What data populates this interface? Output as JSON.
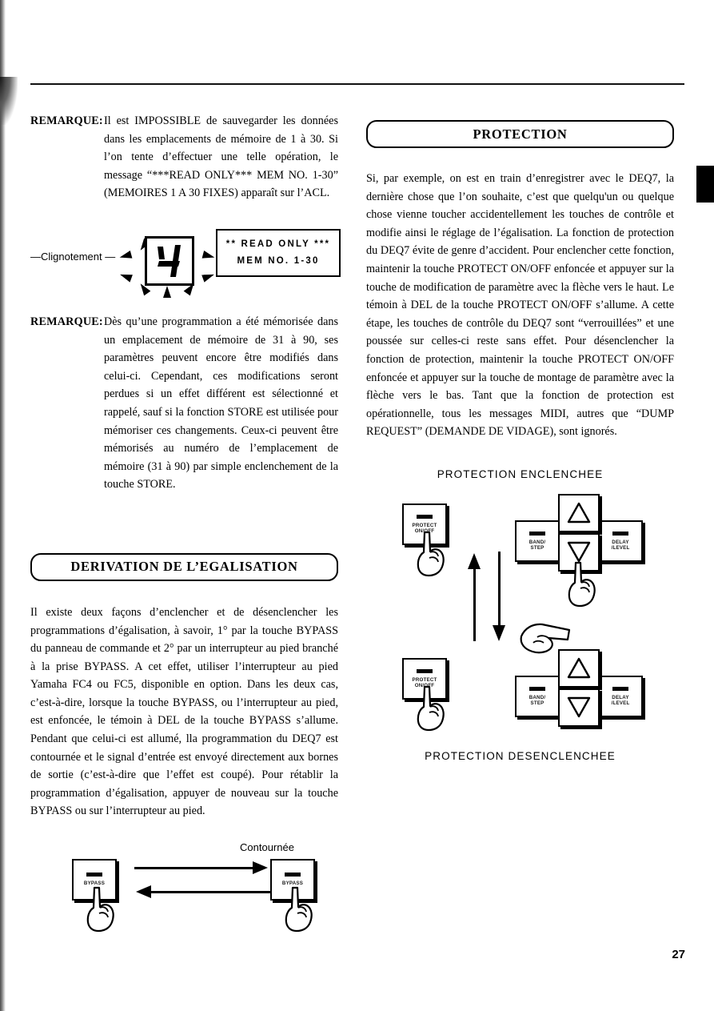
{
  "page": {
    "number": "27",
    "language": "fr"
  },
  "left_column": {
    "note_1": {
      "label": "REMARQUE:",
      "text": "Il est IMPOSSIBLE de sauvegarder les données dans les emplacements de mémoire de 1 à 30. Si l’on tente d’effectuer une telle opération, le message “***READ ONLY*** MEM NO. 1-30” (MEMOIRES 1 A 30 FIXES) apparaît sur l’ACL."
    },
    "lcd_figure": {
      "blink_label": "—Clignotement —",
      "digit": "4",
      "lcd_line_1": "** READ ONLY ***",
      "lcd_line_2": "MEM NO. 1-30"
    },
    "note_2": {
      "label": "REMARQUE:",
      "text": "Dès qu’une programmation a été mémorisée dans un emplacement de mémoire de 31 à 90, ses paramètres peuvent encore être modifiés dans celui-ci. Cependant, ces modifications seront perdues si un effet différent est sélectionné et rappelé, sauf si la fonction STORE est utilisée pour mémoriser ces changements. Ceux-ci peuvent être mémorisés au numéro de l’emplacement de mémoire (31 à 90) par simple enclenchement de la touche STORE."
    },
    "section_heading": "DERIVATION DE L’EGALISATION",
    "section_body": "Il existe deux façons d’enclencher et de désenclencher les programmations d’égalisation, à savoir, 1° par la touche BYPASS du panneau de commande et 2° par un interrupteur au pied branché à la prise BYPASS. A cet effet, utiliser l’interrupteur au pied Yamaha FC4 ou FC5, disponible en option. Dans les deux cas, c’est-à-dire, lorsque la touche BYPASS, ou l’interrupteur au pied, est enfoncée, le témoin à DEL de la touche BYPASS s’allume. Pendant que celui-ci est allumé, lla programmation du DEQ7 est contournée et le signal d’entrée est envoyé directement aux bornes de sortie (c’est-à-dire que l’effet est coupé). Pour rétablir la programmation d’égalisation, appuyer de nouveau sur la touche BYPASS ou sur l’interrupteur au pied.",
    "bypass_figure": {
      "caption": "Contournée",
      "button_left_label": "BYPASS",
      "button_right_label": "BYPASS"
    }
  },
  "right_column": {
    "section_heading": "PROTECTION",
    "section_body": "Si, par exemple, on est en train d’enregistrer avec le DEQ7, la dernière chose que l’on souhaite, c’est que quelqu'un ou quelque chose vienne toucher accidentellement les touches de contrôle et modifie ainsi le réglage de l’égalisation. La fonction de protection du DEQ7 évite de genre d’accident. Pour enclencher cette fonction, maintenir la touche PROTECT ON/OFF enfoncée et appuyer sur la touche de modification de paramètre avec la flèche vers le haut. Le témoin à DEL de la touche PROTECT ON/OFF s’allume. A cette étape, les touches de contrôle du DEQ7 sont “verrouillées” et une poussée sur celles-ci reste sans effet. Pour désenclencher la fonction de protection, maintenir la touche PROTECT ON/OFF enfoncée et appuyer sur la touche de montage de paramètre avec la flèche vers le bas. Tant que la fonction de protection est opérationnelle, tous les messages MIDI, autres que “DUMP REQUEST” (DEMANDE DE VIDAGE), sont ignorés.",
    "figure_top": {
      "caption": "PROTECTION ENCLENCHEE",
      "protect_button_line_1": "PROTECT",
      "protect_button_line_2": "ON/OFF",
      "left_button_line_1": "BAND/",
      "left_button_line_2": "STEP",
      "right_button_line_1": "DELAY",
      "right_button_line_2": "/LEVEL",
      "pressed_arrow": "down"
    },
    "figure_bottom": {
      "caption": "PROTECTION DESENCLENCHEE",
      "protect_button_line_1": "PROTECT",
      "protect_button_line_2": "ON/OFF",
      "left_button_line_1": "BAND/",
      "left_button_line_2": "STEP",
      "right_button_line_1": "DELAY",
      "right_button_line_2": "/LEVEL",
      "pressed_arrow": "up"
    }
  }
}
